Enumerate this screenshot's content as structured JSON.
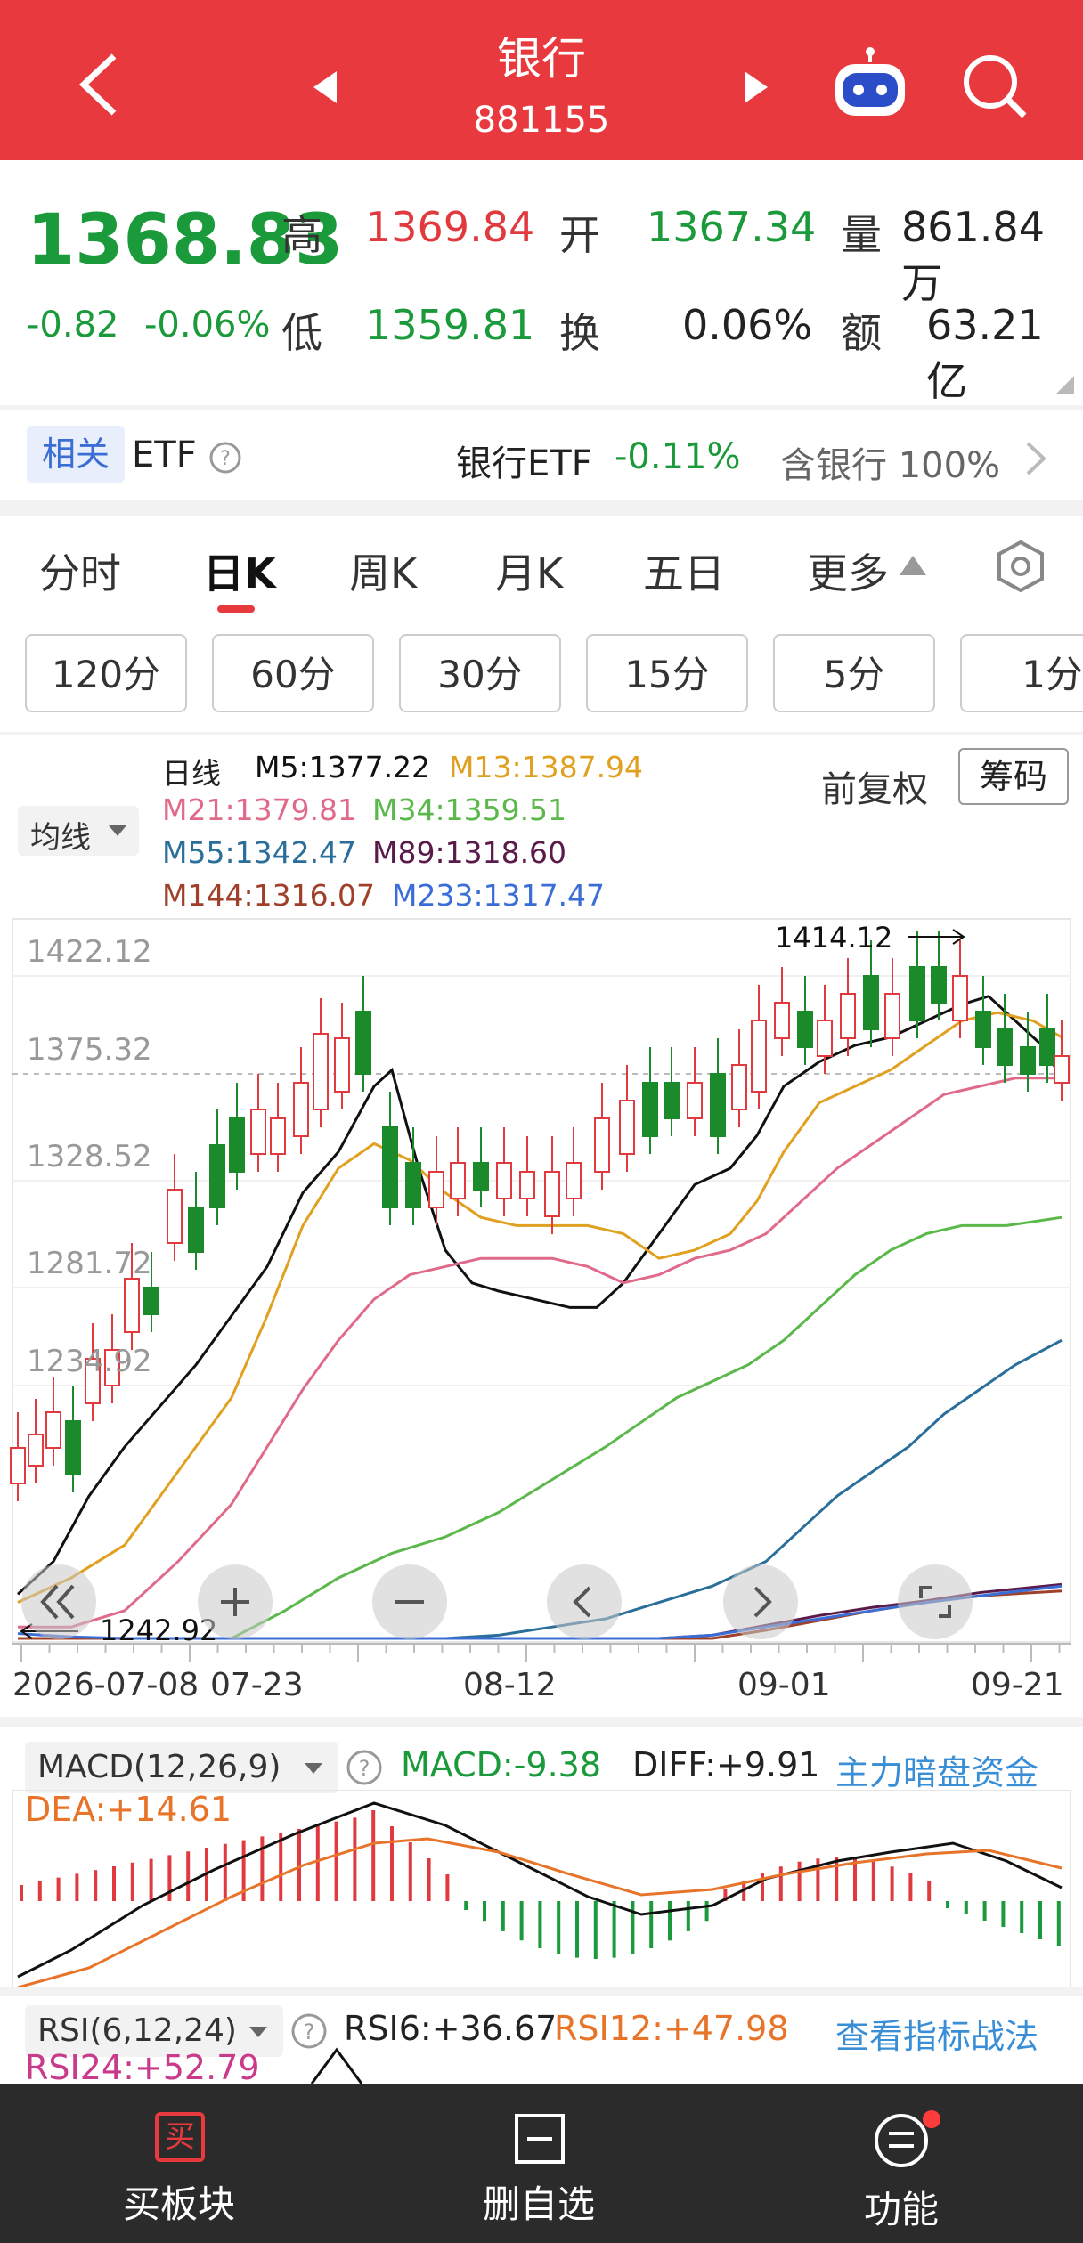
{
  "header": {
    "title": "银行",
    "code": "881155"
  },
  "quote": {
    "price": "1368.83",
    "change": "-0.82",
    "change_pct": "-0.06%",
    "high_label": "高",
    "high": "1369.84",
    "open_label": "开",
    "open": "1367.34",
    "vol_label": "量",
    "volume": "861.84万",
    "low_label": "低",
    "low": "1359.81",
    "turnover_label": "换",
    "turnover": "0.06%",
    "amount_label": "额",
    "amount": "63.21亿"
  },
  "etf": {
    "tag": "相关",
    "label": "ETF",
    "name": "银行ETF",
    "change": "-0.11%",
    "contains": "含银行 100%"
  },
  "tabs": [
    "分时",
    "日K",
    "周K",
    "月K",
    "五日",
    "更多"
  ],
  "active_tab": "日K",
  "intervals": [
    "120分",
    "60分",
    "30分",
    "15分",
    "5分",
    "1分"
  ],
  "ma": {
    "title": "日线",
    "m5": "M5:1377.22",
    "m13": "M13:1387.94",
    "m21": "M21:1379.81",
    "m34": "M34:1359.51",
    "m55": "M55:1342.47",
    "m89": "M89:1318.60",
    "m144": "M144:1316.07",
    "m233": "M233:1317.47",
    "selector": "均线",
    "fq": "前复权",
    "chouma": "筹码"
  },
  "chart_data": {
    "type": "candlestick",
    "y_labels": [
      "1422.12",
      "1375.32",
      "1328.52",
      "1281.72",
      "1234.92"
    ],
    "high_label": "1414.12",
    "low_label": "1242.92",
    "x_labels": [
      "2026-07-08",
      "07-23",
      "08-12",
      "09-01",
      "09-21"
    ],
    "ylim": [
      1234.92,
      1422.12
    ]
  },
  "macd": {
    "title": "MACD(12,26,9)",
    "macd": "MACD:-9.38",
    "diff": "DIFF:+9.91",
    "dea": "DEA:+14.61",
    "link": "主力暗盘资金"
  },
  "rsi": {
    "title": "RSI(6,12,24)",
    "rsi6": "RSI6:+36.67",
    "rsi12": "RSI12:+47.98",
    "rsi24": "RSI24:+52.79",
    "link": "查看指标战法"
  },
  "bottom_nav": {
    "buy": "买板块",
    "buy_icon": "买",
    "remove": "删自选",
    "func": "功能"
  },
  "colors": {
    "red": "#e83a3e",
    "green": "#1a9a3a",
    "blue": "#3a8ed6"
  }
}
